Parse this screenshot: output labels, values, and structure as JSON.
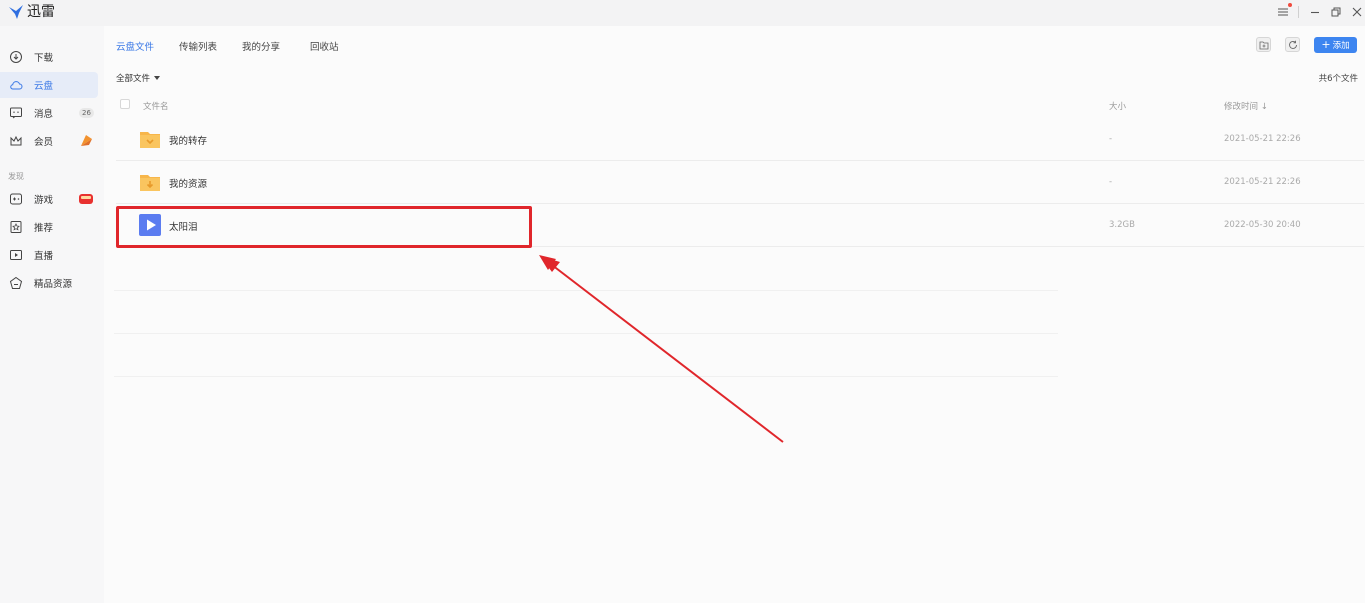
{
  "app": {
    "title": "迅雷"
  },
  "sidebar": {
    "items": [
      {
        "label": "下载",
        "icon": "download-icon"
      },
      {
        "label": "云盘",
        "icon": "cloud-icon"
      },
      {
        "label": "消息",
        "icon": "message-icon",
        "badge": "26"
      },
      {
        "label": "会员",
        "icon": "crown-icon"
      }
    ],
    "section_label": "发现",
    "discover": [
      {
        "label": "游戏",
        "icon": "gamepad-icon"
      },
      {
        "label": "推荐",
        "icon": "recommend-icon"
      },
      {
        "label": "直播",
        "icon": "live-icon"
      },
      {
        "label": "精品资源",
        "icon": "gem-icon"
      }
    ]
  },
  "tabs": [
    {
      "label": "云盘文件"
    },
    {
      "label": "传输列表"
    },
    {
      "label": "我的分享"
    },
    {
      "label": "回收站"
    }
  ],
  "toolbar": {
    "add_label": "添加"
  },
  "filter": {
    "label": "全部文件"
  },
  "file_count": "共6个文件",
  "table": {
    "headers": {
      "name": "文件名",
      "size": "大小",
      "modified": "修改时间 ↓"
    },
    "rows": [
      {
        "name": "我的转存",
        "size": "-",
        "date": "2021-05-21 22:26",
        "icon": "folder-transfer-icon"
      },
      {
        "name": "我的资源",
        "size": "-",
        "date": "2021-05-21 22:26",
        "icon": "folder-download-icon"
      },
      {
        "name": "太阳泪",
        "size": "3.2GB",
        "date": "2022-05-30 20:40",
        "icon": "video-file-icon"
      }
    ]
  },
  "colors": {
    "accent": "#3a78e6",
    "highlight": "#e0262b",
    "folder": "#f7b64b",
    "video": "#5b7cf0"
  }
}
